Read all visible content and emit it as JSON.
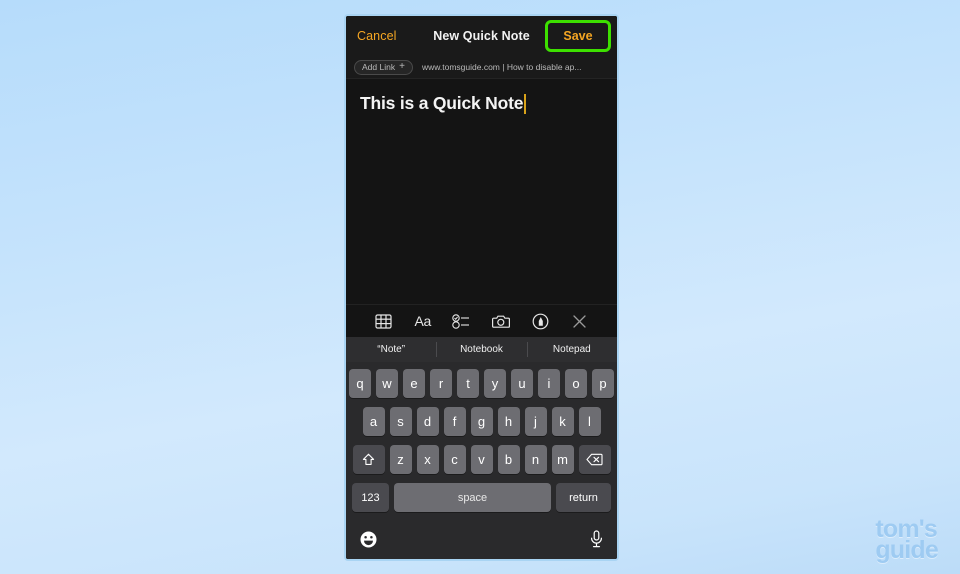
{
  "background": {
    "gradient_from": "#b6dcfb",
    "gradient_to": "#bcdcf8"
  },
  "highlight": {
    "color": "#3de000",
    "target": "Save"
  },
  "phone": {
    "navbar": {
      "cancel_label": "Cancel",
      "title": "New Quick Note",
      "save_label": "Save",
      "accent_color": "#f5a623"
    },
    "linkbar": {
      "add_link_label": "Add Link",
      "add_link_plus": "+",
      "url_text": "www.tomsguide.com | How to disable ap..."
    },
    "note": {
      "title_text": "This is a Quick Note",
      "caret_color": "#d8a21a"
    },
    "format_toolbar": {
      "items": [
        {
          "name": "table-icon",
          "label": "Table"
        },
        {
          "name": "text-format-icon",
          "label": "Aa"
        },
        {
          "name": "checklist-icon",
          "label": "Checklist"
        },
        {
          "name": "camera-icon",
          "label": "Camera"
        },
        {
          "name": "markup-pen-icon",
          "label": "Markup"
        },
        {
          "name": "close-icon",
          "label": "Close"
        }
      ]
    },
    "predictive": {
      "suggestions": [
        "“Note”",
        "Notebook",
        "Notepad"
      ]
    },
    "keyboard": {
      "row1": [
        "q",
        "w",
        "e",
        "r",
        "t",
        "y",
        "u",
        "i",
        "o",
        "p"
      ],
      "row2": [
        "a",
        "s",
        "d",
        "f",
        "g",
        "h",
        "j",
        "k",
        "l"
      ],
      "row3": [
        "z",
        "x",
        "c",
        "v",
        "b",
        "n",
        "m"
      ],
      "shift_label": "shift",
      "backspace_label": "delete",
      "numbers_label": "123",
      "space_label": "space",
      "return_label": "return",
      "emoji_label": "emoji",
      "dictation_label": "dictation"
    }
  },
  "watermark": {
    "line1": "tom's",
    "line2": "guide",
    "color": "#9ecbf2"
  }
}
